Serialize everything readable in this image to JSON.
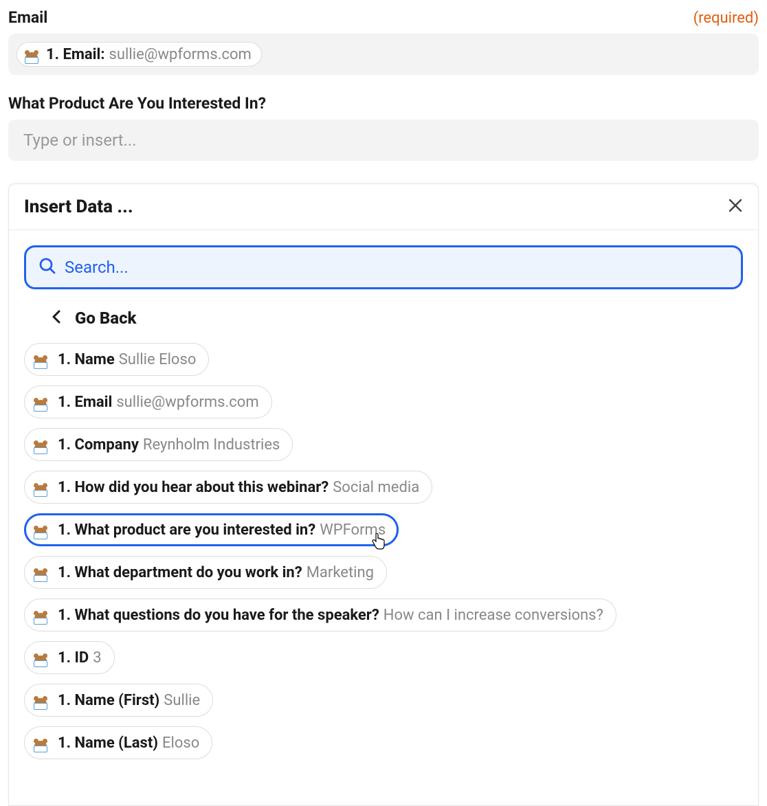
{
  "fields": {
    "email": {
      "label": "Email",
      "required_text": "(required)",
      "token_prefix": "1. Email:",
      "token_value": "sullie@wpforms.com"
    },
    "product": {
      "label": "What Product Are You Interested In?",
      "placeholder": "Type or insert..."
    }
  },
  "modal": {
    "title": "Insert Data ...",
    "search_placeholder": "Search...",
    "go_back": "Go Back"
  },
  "data_items": [
    {
      "prefix": "1. Name",
      "value": "Sullie Eloso",
      "selected": false
    },
    {
      "prefix": "1. Email",
      "value": "sullie@wpforms.com",
      "selected": false
    },
    {
      "prefix": "1. Company",
      "value": "Reynholm Industries",
      "selected": false
    },
    {
      "prefix": "1. How did you hear about this webinar?",
      "value": "Social media",
      "selected": false
    },
    {
      "prefix": "1. What product are you interested in?",
      "value": "WPForms",
      "selected": true
    },
    {
      "prefix": "1. What department do you work in?",
      "value": "Marketing",
      "selected": false
    },
    {
      "prefix": "1. What questions do you have for the speaker?",
      "value": "How can I increase conversions?",
      "selected": false
    },
    {
      "prefix": "1. ID",
      "value": "3",
      "selected": false
    },
    {
      "prefix": "1. Name (First)",
      "value": "Sullie",
      "selected": false
    },
    {
      "prefix": "1. Name (Last)",
      "value": "Eloso",
      "selected": false
    }
  ]
}
